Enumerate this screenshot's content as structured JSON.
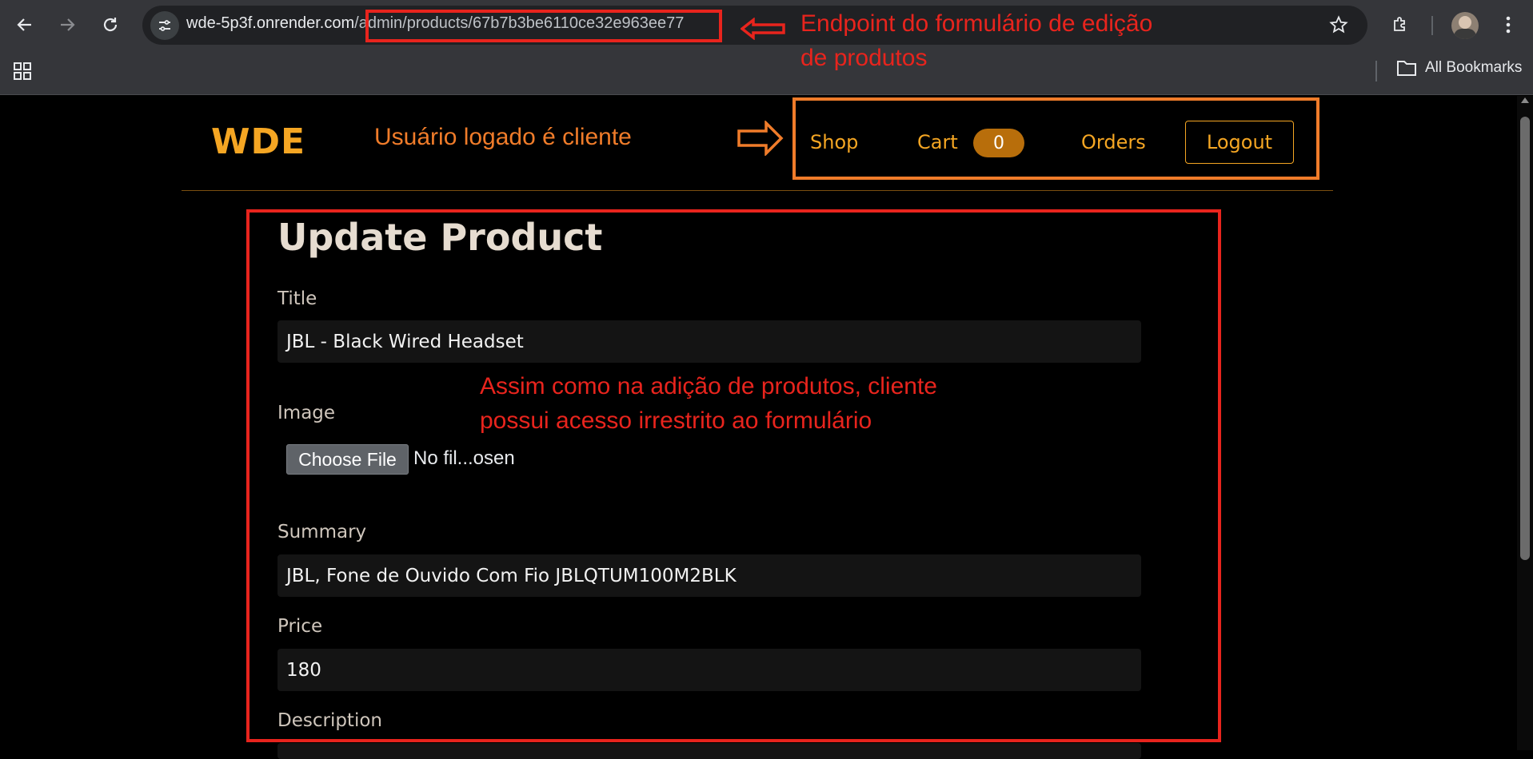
{
  "browser": {
    "url_host": "wde-5p3f.onrender.com",
    "url_path": "/admin/products/67b7b3be6110ce32e963ee77",
    "bookmarks_label": "All Bookmarks"
  },
  "annotations": {
    "endpoint_line1": "Endpoint do formulário de edição",
    "endpoint_line2": "de produtos",
    "logged_user": "Usuário logado é cliente",
    "access_line1": "Assim como na adição de produtos, cliente",
    "access_line2": "possui acesso irrestrito ao formulário"
  },
  "header": {
    "brand": "WDE",
    "nav": {
      "shop": "Shop",
      "cart": "Cart",
      "cart_count": "0",
      "orders": "Orders",
      "logout": "Logout"
    }
  },
  "form": {
    "title": "Update Product",
    "title_label": "Title",
    "title_value": "JBL - Black Wired Headset",
    "image_label": "Image",
    "file_button": "Choose File",
    "file_status": "No fil...osen",
    "summary_label": "Summary",
    "summary_value": "JBL, Fone de Ouvido Com Fio JBLQTUM100M2BLK",
    "price_label": "Price",
    "price_value": "180",
    "description_label": "Description"
  },
  "colors": {
    "accent": "#f5a623",
    "annotation_red": "#e8241d",
    "annotation_orange": "#f07c2a"
  }
}
